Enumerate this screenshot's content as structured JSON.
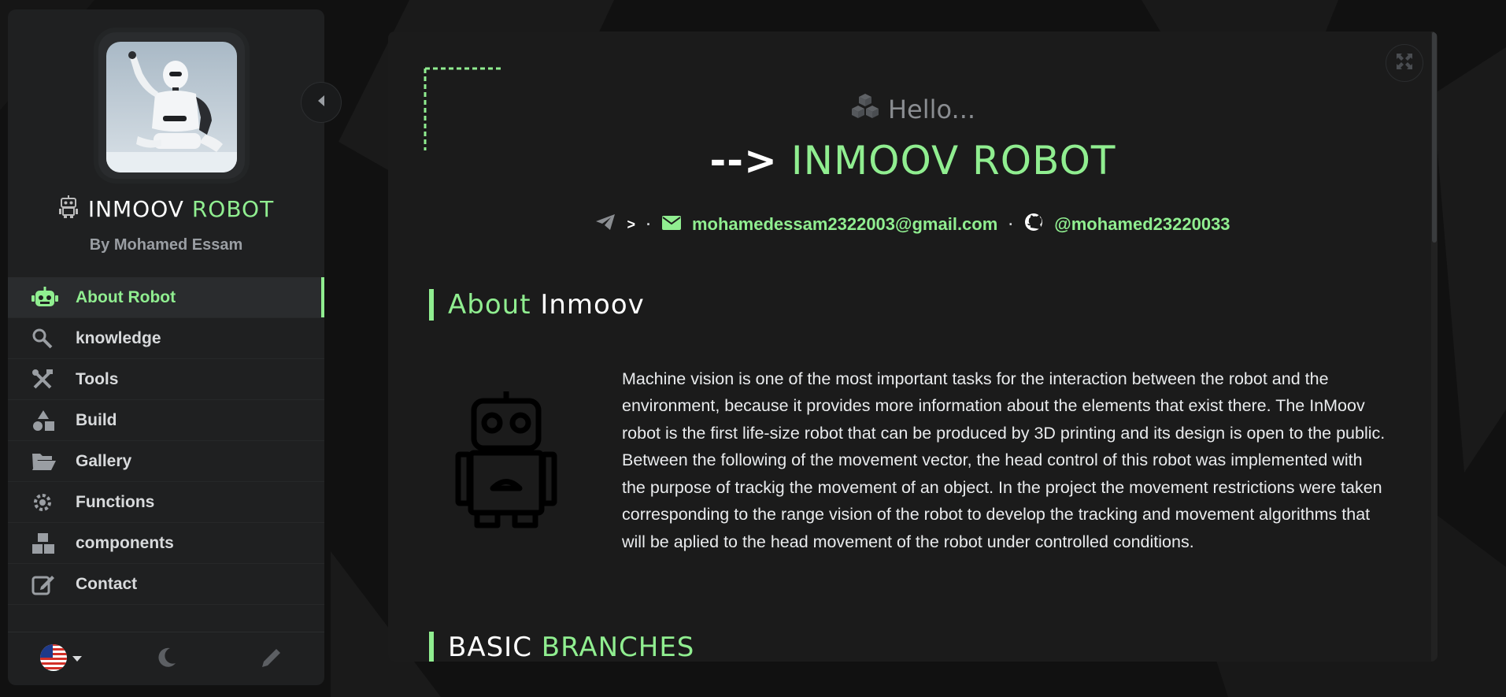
{
  "sidebar": {
    "brand_first": "INMOOV",
    "brand_second": "ROBOT",
    "byline": "By Mohamed Essam",
    "nav": [
      {
        "label": "About Robot",
        "icon": "robot-icon",
        "active": true
      },
      {
        "label": "knowledge",
        "icon": "search-magnify-icon",
        "active": false
      },
      {
        "label": "Tools",
        "icon": "tools-icon",
        "active": false
      },
      {
        "label": "Build",
        "icon": "shapes-icon",
        "active": false
      },
      {
        "label": "Gallery",
        "icon": "folder-open-icon",
        "active": false
      },
      {
        "label": "Functions",
        "icon": "atom-gear-icon",
        "active": false
      },
      {
        "label": "components",
        "icon": "boxes-icon",
        "active": false
      },
      {
        "label": "Contact",
        "icon": "edit-icon",
        "active": false
      }
    ],
    "footer": {
      "language_icon": "us-flag-icon",
      "theme_icon": "moon-icon",
      "customize_icon": "pencil-icon"
    }
  },
  "header": {
    "hello": "Hello...",
    "arrow": "-->",
    "title": "INMOOV ROBOT",
    "contact_prefix": ">",
    "email": "mohamedessam2322003@gmail.com",
    "github": "@mohamed23220033"
  },
  "about": {
    "title_first": "About",
    "title_second": "Inmoov",
    "text": "Machine vision is one of the most important tasks for the interaction between the robot and the environment, because it provides more information about the elements that exist there. The InMoov robot is the first life-size robot that can be produced by 3D printing and its design is open to the public. Between the following of the movement vector, the head control of this robot was implemented with the purpose of trackig the movement of an object. In the project the movement restrictions were taken corresponding to the range vision of the robot to develop the tracking and movement algorithms that will be aplied to the head movement of the robot under controlled conditions."
  },
  "branches": {
    "title_first": "BASIC",
    "title_second": "BRANCHES"
  },
  "colors": {
    "accent": "#90ee90",
    "panel": "#1b1b1b",
    "sidebar": "#1f2021",
    "background": "#0d0d0d"
  }
}
